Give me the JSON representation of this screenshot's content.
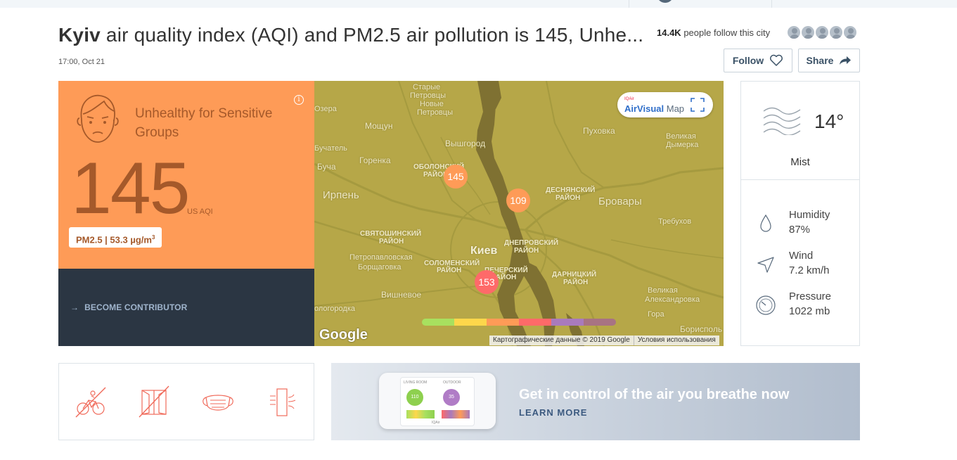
{
  "header": {
    "city": "Kyiv",
    "title_rest": " air quality index (AQI) and PM2.5 air pollution is 145, Unhe...",
    "updated": "17:00, Oct 21",
    "followers_count": "14.4K",
    "followers_text": "people follow this city",
    "follow_label": "Follow",
    "share_label": "Share"
  },
  "aqi": {
    "status": "Unhealthy for Sensitive Groups",
    "value": "145",
    "unit": "US AQI",
    "pm_label": "PM2.5 | 53.3 µg/m",
    "pm_sup": "3",
    "info_glyph": "i",
    "face_icon": "sad-face-icon",
    "card_color": "#fe9b57",
    "text_color": "#a5592a"
  },
  "contributor": {
    "label": "BECOME CONTRIBUTOR",
    "arrow": "→"
  },
  "map": {
    "brand_small": "IQAir",
    "brand": "AirVisual",
    "brand_suffix": "Map",
    "markers": [
      {
        "value": "145",
        "color": "#fe9b57"
      },
      {
        "value": "109",
        "color": "#fe9b57"
      },
      {
        "value": "153",
        "color": "#fe6a69"
      }
    ],
    "legend_colors": [
      "#a8e05f",
      "#fdd74b",
      "#fe9b57",
      "#fe6a69",
      "#a97abc",
      "#a87383"
    ],
    "places": [
      "Старые",
      "Петровцы",
      "Новые",
      "Петровцы",
      "Озера",
      "Мощун",
      "Вышгород",
      "Пуховка",
      "Великая",
      "Дымерка",
      "Горенка",
      "Бучатель",
      "Буча",
      "ОБОЛОНСКИЙ",
      "РАЙОН",
      "ДЕСНЯНСКИЙ",
      "РАЙОН",
      "Ирпень",
      "Бровары",
      "Требухов",
      "СВЯТОШИНСКИЙ",
      "РАЙОН",
      "ДНЕПРОВСКИЙ",
      "РАЙОН",
      "Киев",
      "Петропавловская",
      "Борщаговка",
      "СОЛОМЕНСКИЙ",
      "РАЙОН",
      "ПЕЧЕРСКИЙ",
      "РАЙОН",
      "ДАРНИЦКИЙ",
      "РАЙОН",
      "Вишневое",
      "Великая",
      "Александровка",
      "Гора",
      "ологородка",
      "Борисполь"
    ],
    "google": "Google",
    "copyright": "Картографические данные © 2019 Google",
    "terms": "Условия использования"
  },
  "weather": {
    "icon": "mist-icon",
    "temp": "14°",
    "condition": "Mist",
    "rows": [
      {
        "icon": "humidity-icon",
        "label": "Humidity",
        "value": "87%"
      },
      {
        "icon": "wind-icon",
        "label": "Wind",
        "value": "7.2 km/h"
      },
      {
        "icon": "pressure-icon",
        "label": "Pressure",
        "value": "1022 mb"
      }
    ]
  },
  "tips": {
    "icons": [
      "no-cycling-icon",
      "close-windows-icon",
      "face-mask-icon",
      "air-purifier-icon"
    ],
    "color": "#f06a5a"
  },
  "promo": {
    "title": "Get in control of the air you breathe now",
    "link": "LEARN MORE",
    "screen_left_label": "LIVING ROOM",
    "screen_right_label": "OUTDOOR",
    "screen_left_value": "110",
    "screen_right_value": "35",
    "screen_brand": "IQAir"
  }
}
